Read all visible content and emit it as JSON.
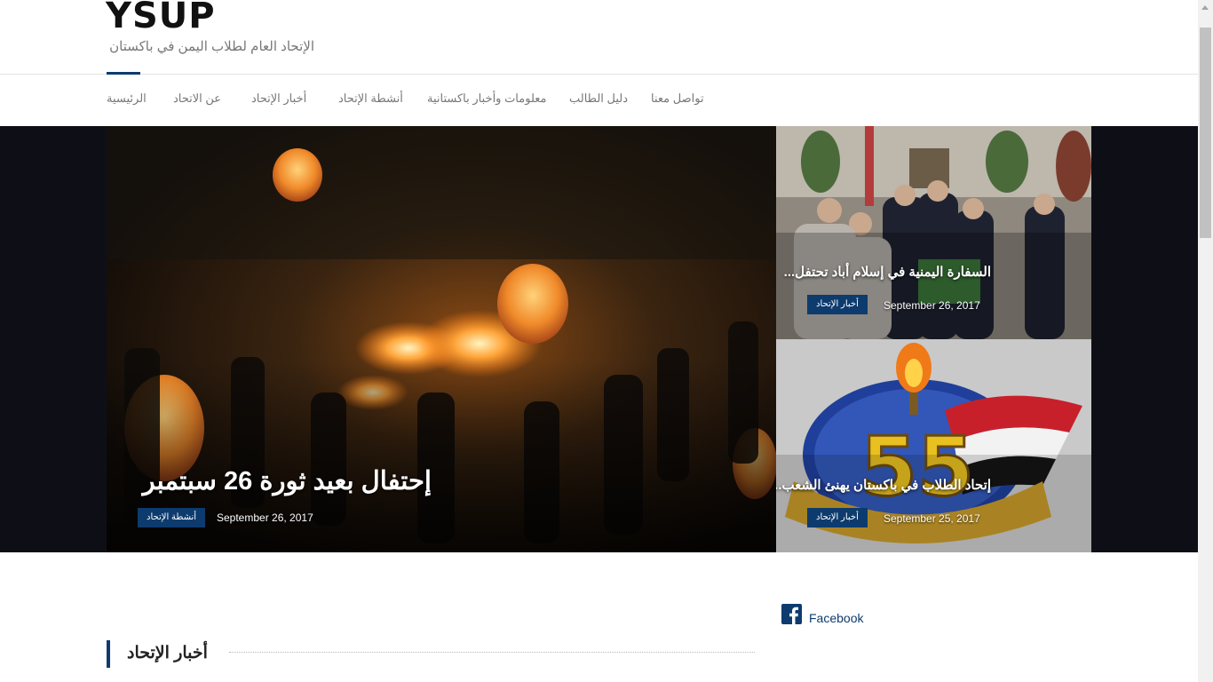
{
  "site": {
    "title": "YSUP",
    "tagline": "الإتحاد العام لطلاب اليمن في باكستان"
  },
  "nav": {
    "items": [
      {
        "label": "الرئيسية"
      },
      {
        "label": "عن الاتحاد"
      },
      {
        "label": "أخبار الإتحاد"
      },
      {
        "label": "أنشطة الإتحاد"
      },
      {
        "label": "معلومات وأخبار باكستانية"
      },
      {
        "label": "دليل الطالب"
      },
      {
        "label": "تواصل معنا"
      }
    ]
  },
  "hero": {
    "main": {
      "title": "إحتفال بعيد ثورة 26 سبتمبر",
      "category": "أنشطة الإتحاد",
      "date": "September 26, 2017"
    },
    "side": [
      {
        "title": "السفارة اليمنية في إسلام أباد تحتفل...",
        "category": "أخبار الإتحاد",
        "date": "September 26, 2017"
      },
      {
        "title": "إتحاد الطلاب في باكستان يهنئ الشعب...",
        "category": "أخبار الإتحاد",
        "date": "September 25, 2017"
      }
    ]
  },
  "sidebar": {
    "facebook_label": "Facebook"
  },
  "section": {
    "title": "أخبار الإتحاد"
  },
  "colors": {
    "accent": "#0d3b6e",
    "hero_bg": "#0e0f16"
  }
}
